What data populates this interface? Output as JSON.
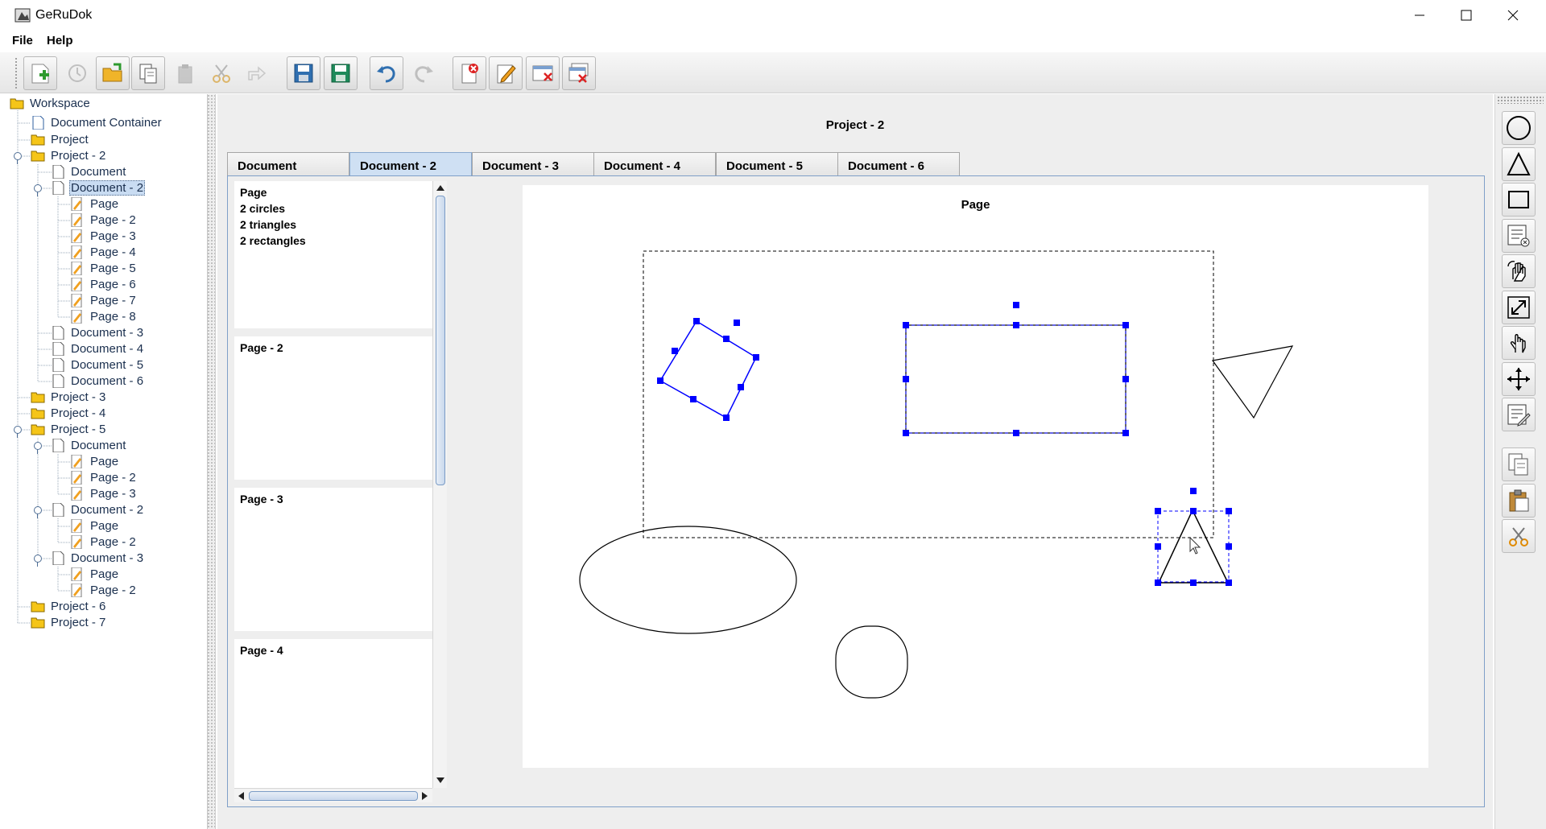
{
  "window": {
    "title": "GeRuDok"
  },
  "menu": {
    "file": "File",
    "help": "Help"
  },
  "toolbar": {
    "buttons": [
      {
        "name": "new-icon"
      },
      {
        "name": "reload-icon"
      },
      {
        "name": "open-folder-icon"
      },
      {
        "name": "copy-icon"
      },
      {
        "name": "paste-icon"
      },
      {
        "name": "cut-icon"
      },
      {
        "name": "share-icon"
      },
      {
        "name": "save-icon"
      },
      {
        "name": "save-as-icon"
      },
      {
        "name": "undo-icon"
      },
      {
        "name": "redo-icon"
      },
      {
        "name": "delete-document-icon"
      },
      {
        "name": "rename-icon"
      },
      {
        "name": "close-window-icon"
      },
      {
        "name": "close-all-icon"
      }
    ]
  },
  "tree": {
    "workspace": "Workspace",
    "document_container": "Document Container",
    "project": "Project",
    "project_2": "Project - 2",
    "p2_document": "Document",
    "p2_document_2": "Document - 2",
    "p2_d2_pages": [
      "Page",
      "Page - 2",
      "Page - 3",
      "Page - 4",
      "Page - 5",
      "Page - 6",
      "Page - 7",
      "Page - 8"
    ],
    "p2_document_3": "Document - 3",
    "p2_document_4": "Document - 4",
    "p2_document_5": "Document - 5",
    "p2_document_6": "Document - 6",
    "project_3": "Project - 3",
    "project_4": "Project - 4",
    "project_5": "Project - 5",
    "p5_document": "Document",
    "p5_d1_pages": [
      "Page",
      "Page - 2",
      "Page - 3"
    ],
    "p5_document_2": "Document - 2",
    "p5_d2_pages": [
      "Page",
      "Page - 2"
    ],
    "p5_document_3": "Document - 3",
    "p5_d3_pages": [
      "Page",
      "Page - 2"
    ],
    "project_6": "Project - 6",
    "project_7": "Project - 7"
  },
  "main": {
    "project_title": "Project - 2",
    "tabs": [
      "Document",
      "Document - 2",
      "Document - 3",
      "Document - 4",
      "Document - 5",
      "Document - 6"
    ],
    "active_tab": "Document - 2",
    "thumbnails": [
      {
        "title": "Page",
        "lines": [
          "2 circles",
          "2 triangles",
          "2 rectangles"
        ]
      },
      {
        "title": "Page - 2",
        "lines": []
      },
      {
        "title": "Page - 3",
        "lines": []
      },
      {
        "title": "Page - 4",
        "lines": []
      }
    ],
    "page_title": "Page"
  },
  "colors": {
    "selection": "#0000ff",
    "shape_stroke": "#000000",
    "tab_active": "#cfe0f3",
    "folder": "#f5c518"
  }
}
